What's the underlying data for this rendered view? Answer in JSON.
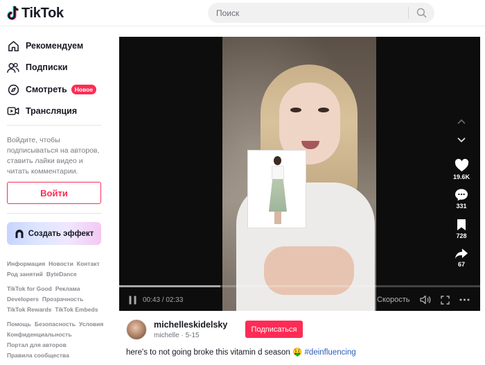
{
  "header": {
    "logo_text": "TikTok",
    "search_placeholder": "Поиск"
  },
  "sidebar": {
    "nav": [
      {
        "label": "Рекомендуем",
        "icon": "home-icon"
      },
      {
        "label": "Подписки",
        "icon": "following-icon"
      },
      {
        "label": "Смотреть",
        "icon": "explore-icon",
        "badge": "Новое"
      },
      {
        "label": "Трансляция",
        "icon": "live-icon"
      }
    ],
    "login_prompt": "Войдите, чтобы подписываться на авторов, ставить лайки видео и читать комментарии.",
    "login_button": "Войти",
    "effect_button": "Создать эффект",
    "footer": [
      [
        "Информация",
        "Новости",
        "Контакт",
        "Род занятий",
        "ByteDance"
      ],
      [
        "TikTok for Good",
        "Реклама",
        "Developers",
        "Прозрачность",
        "TikTok Rewards",
        "TikTok Embeds"
      ],
      [
        "Помощь",
        "Безопасность",
        "Условия",
        "Конфиденциальность",
        "Портал для авторов",
        "Правила сообщества"
      ]
    ]
  },
  "video": {
    "time": "00:43 / 02:33",
    "progress": 0.28,
    "speed_label": "Скорость",
    "likes": "19.6K",
    "comments": "331",
    "saves": "728",
    "shares": "67"
  },
  "author": {
    "username": "michelleskidelsky",
    "display": "michelle · 5-15",
    "follow_button": "Подписаться"
  },
  "caption": {
    "text": "here's to not going broke this vitamin d season 🤑",
    "hashtag": "#deinfluencing"
  },
  "colors": {
    "brand": "#fe2c55",
    "link": "#2b5db9"
  }
}
